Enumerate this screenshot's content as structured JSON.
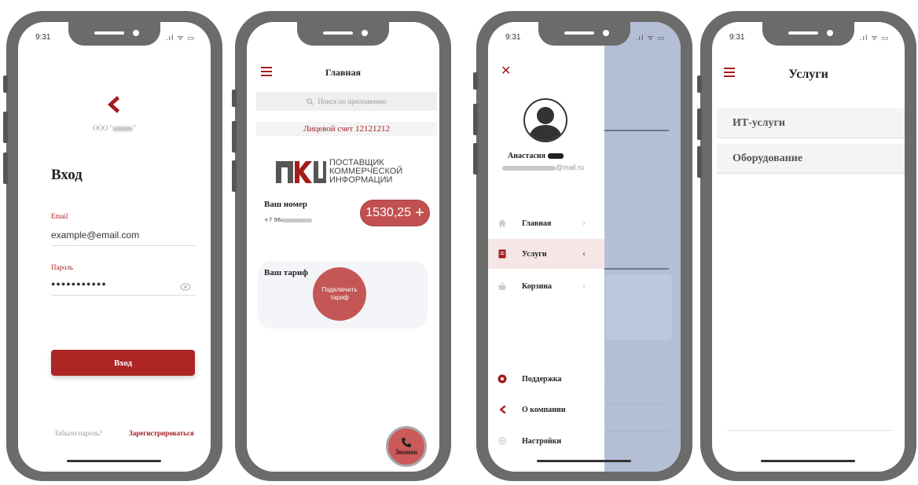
{
  "status": {
    "time": "9:31",
    "icons": ".ıl ᯤ ▭"
  },
  "login": {
    "brand": "ООО \"",
    "brand_suffix": "\"",
    "title": "Вход",
    "email_label": "Email",
    "email_value": "example@email.com",
    "password_label": "Пароль",
    "password_value": "●●●●●●●●●●●",
    "submit_label": "Вход",
    "forgot_label": "Забыли пароль?",
    "register_label": "Зарегистрироваться"
  },
  "home": {
    "title": "Главная",
    "search_placeholder": "Поиск по приложению",
    "account": "Лицевой счет 12121212",
    "logo_mark": "ПКЦ",
    "logo_lines": [
      "ПОСТАВЩИК",
      "КОММЕРЧЕСКОЙ",
      "ИНФОРМАЦИИ"
    ],
    "number_label": "Ваш номер",
    "number_prefix": "+7 96",
    "balance": "1530,25",
    "balance_plus": "+",
    "tariff_label": "Ваш тариф",
    "connect_label": "Подключить тариф",
    "call_label": "Звонок"
  },
  "menu": {
    "close": "✕",
    "user_name": "Анастасия",
    "email_suffix": "@mail.ru",
    "items": [
      {
        "label": "Главная",
        "icon": "home-icon",
        "chevron": "›"
      },
      {
        "label": "Услуги",
        "icon": "document-icon",
        "chevron": "‹"
      },
      {
        "label": "Корзина",
        "icon": "basket-icon",
        "chevron": "›"
      }
    ],
    "bottom_items": [
      {
        "label": "Поддержка",
        "icon": "support-icon"
      },
      {
        "label": "О компании",
        "icon": "company-logo-icon"
      },
      {
        "label": "Настройки",
        "icon": "settings-icon"
      }
    ]
  },
  "services": {
    "title": "Услуги",
    "items": [
      "ИТ-услуги",
      "Оборудование"
    ]
  },
  "colors": {
    "accent": "#a31d1d",
    "frame": "#6b6b6b",
    "overlay": "#b4bfd6"
  }
}
